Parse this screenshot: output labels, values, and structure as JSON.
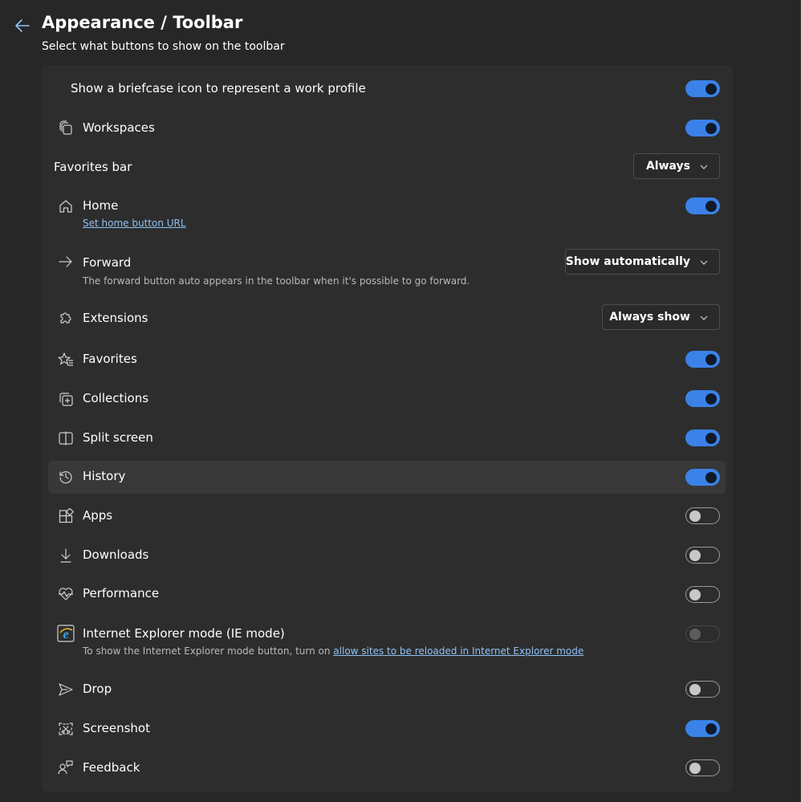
{
  "header": {
    "title": "Appearance / Toolbar",
    "subtitle": "Select what buttons to show on the toolbar",
    "back_icon": "arrow-left-icon"
  },
  "colors": {
    "accent": "#3b82e8",
    "link": "#8fc2f5",
    "background": "#272727",
    "card": "#2d2d2d"
  },
  "settings": {
    "work_profile": {
      "label": "Show a briefcase icon to represent a work profile",
      "on": true
    },
    "workspaces": {
      "label": "Workspaces",
      "icon": "workspaces-icon",
      "on": true
    },
    "favorites_bar": {
      "label": "Favorites bar",
      "value": "Always"
    },
    "home": {
      "label": "Home",
      "icon": "home-icon",
      "link": "Set home button URL",
      "on": true
    },
    "forward": {
      "label": "Forward",
      "icon": "arrow-right-icon",
      "description": "The forward button auto appears in the toolbar when it's possible to go forward.",
      "value": "Show automatically"
    },
    "extensions": {
      "label": "Extensions",
      "icon": "puzzle-icon",
      "value": "Always show"
    },
    "favorites": {
      "label": "Favorites",
      "icon": "star-list-icon",
      "on": true
    },
    "collections": {
      "label": "Collections",
      "icon": "collections-icon",
      "on": true
    },
    "split_screen": {
      "label": "Split screen",
      "icon": "split-screen-icon",
      "on": true
    },
    "history": {
      "label": "History",
      "icon": "history-icon",
      "on": true
    },
    "apps": {
      "label": "Apps",
      "icon": "apps-icon",
      "on": false
    },
    "downloads": {
      "label": "Downloads",
      "icon": "download-icon",
      "on": false
    },
    "performance": {
      "label": "Performance",
      "icon": "heartbeat-icon",
      "on": false
    },
    "ie_mode": {
      "label": "Internet Explorer mode (IE mode)",
      "icon": "internet-explorer-icon",
      "description_prefix": "To show the Internet Explorer mode button, turn on ",
      "description_link": "allow sites to be reloaded in Internet Explorer mode",
      "on": false,
      "disabled": true
    },
    "drop": {
      "label": "Drop",
      "icon": "send-icon",
      "on": false
    },
    "screenshot": {
      "label": "Screenshot",
      "icon": "screenshot-icon",
      "on": true
    },
    "feedback": {
      "label": "Feedback",
      "icon": "feedback-icon",
      "on": false
    }
  }
}
